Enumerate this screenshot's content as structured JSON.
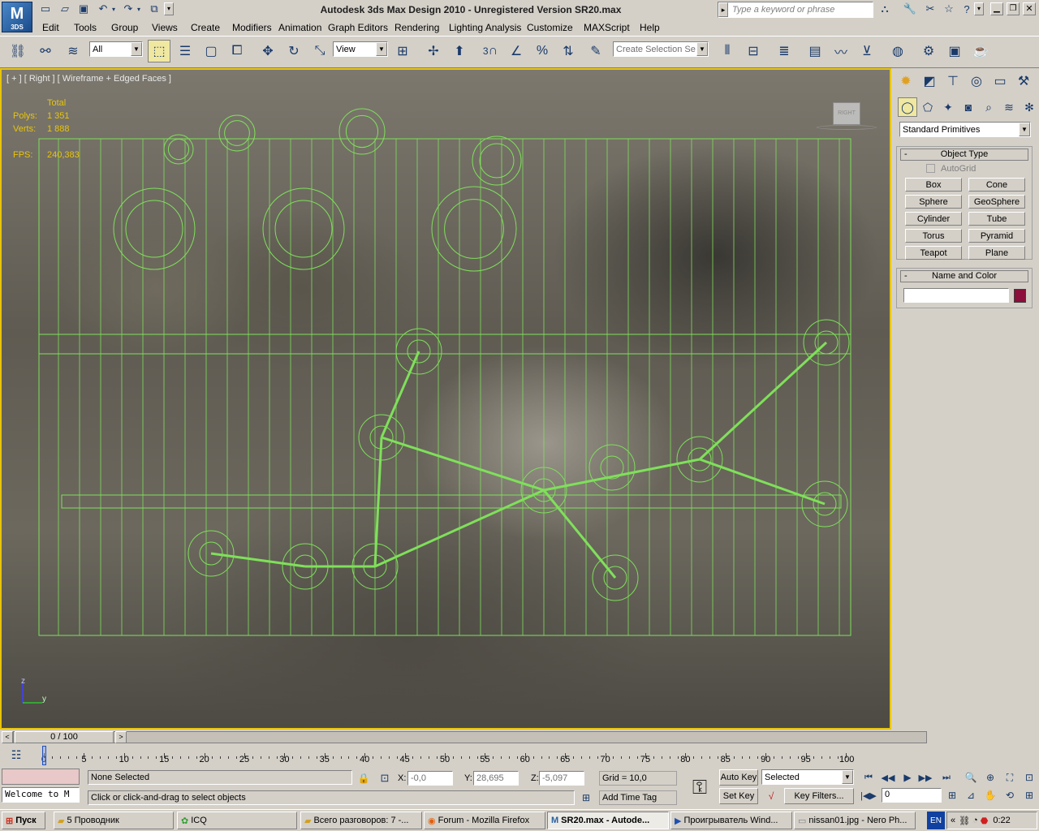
{
  "window": {
    "title": "Autodesk 3ds Max Design 2010  - Unregistered Version    SR20.max",
    "app_badge": "3DS",
    "search_placeholder": "Type a keyword or phrase"
  },
  "menus": [
    "Edit",
    "Tools",
    "Group",
    "Views",
    "Create",
    "Modifiers",
    "Animation",
    "Graph Editors",
    "Rendering",
    "Lighting Analysis",
    "Customize",
    "MAXScript",
    "Help"
  ],
  "toolbar": {
    "selection_filter": "All",
    "ref_coord": "View",
    "named_selection_placeholder": "Create Selection Se",
    "snap_label": "3",
    "percent_label": "%"
  },
  "viewport": {
    "label": "[ + ] [ Right ] [ Wireframe + Edged Faces ]",
    "stats": {
      "header": "Total",
      "polys_label": "Polys:",
      "polys": "1 351",
      "verts_label": "Verts:",
      "verts": "1 888",
      "fps_label": "FPS:",
      "fps": "240,383"
    },
    "viewcube_label": "RIGHT",
    "axis_labels": {
      "z": "z",
      "y": "y"
    }
  },
  "command_panel": {
    "category": "Standard Primitives",
    "object_type_title": "Object Type",
    "autogrid_label": "AutoGrid",
    "buttons": [
      "Box",
      "Cone",
      "Sphere",
      "GeoSphere",
      "Cylinder",
      "Tube",
      "Torus",
      "Pyramid",
      "Teapot",
      "Plane"
    ],
    "name_color_title": "Name and Color",
    "name_value": "",
    "object_color": "#8c0e3a"
  },
  "timeline": {
    "frame_display": "0 / 100",
    "ticks": [
      "0",
      "5",
      "10",
      "15",
      "20",
      "25",
      "30",
      "35",
      "40",
      "45",
      "50",
      "55",
      "60",
      "65",
      "70",
      "75",
      "80",
      "85",
      "90",
      "95",
      "100"
    ]
  },
  "status": {
    "listener_text": "Welcome to M",
    "selection_text": "None Selected",
    "prompt_text": "Click or click-and-drag to select objects",
    "x_label": "X:",
    "x_value": "-0,0",
    "y_label": "Y:",
    "y_value": "28,695",
    "z_label": "Z:",
    "z_value": "-5,097",
    "grid_text": "Grid = 10,0",
    "add_time_tag": "Add Time Tag",
    "auto_key": "Auto Key",
    "set_key": "Set Key",
    "key_mode": "Selected",
    "key_filters": "Key Filters...",
    "current_frame": "0"
  },
  "taskbar": {
    "start_label": "Пуск",
    "tasks": [
      "5 Проводник",
      "ICQ",
      "Всего разговоров: 7 -...",
      "Forum - Mozilla Firefox",
      "SR20.max - Autode...",
      "Проигрыватель Wind...",
      "nissan01.jpg - Nero Ph..."
    ],
    "lang": "EN",
    "clock": "0:22"
  },
  "colors": {
    "accent": "#e8c40c",
    "wire": "#7fe05a",
    "stat_text": "#e8c40c"
  }
}
